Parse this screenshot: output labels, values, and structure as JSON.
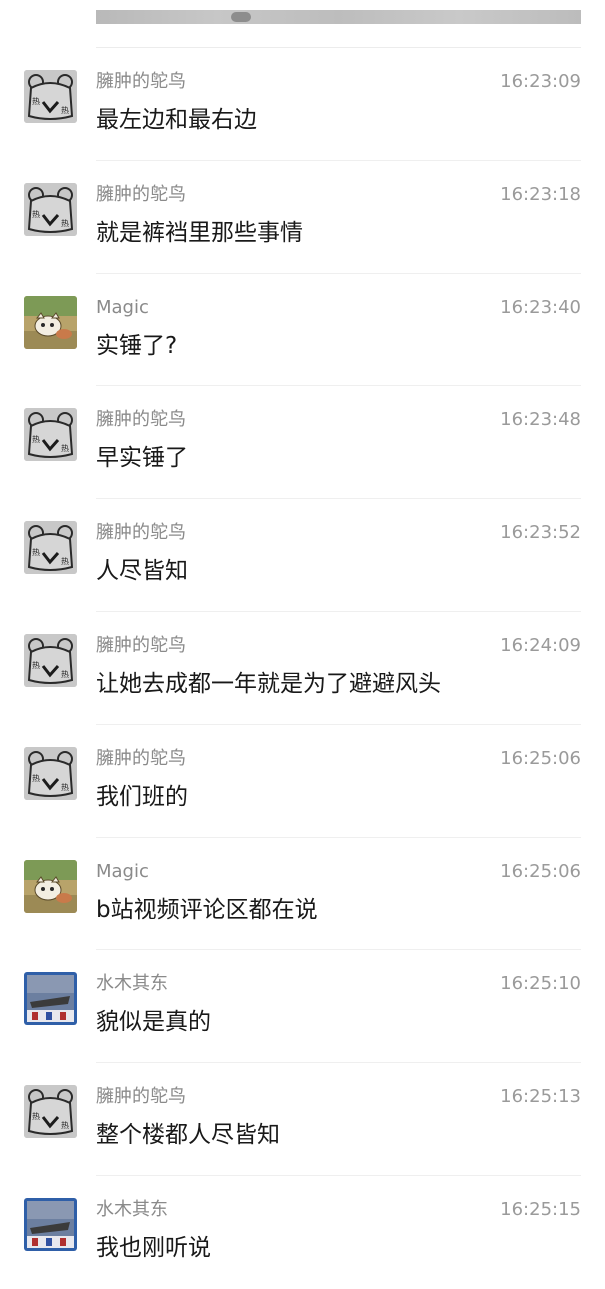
{
  "messages": [
    {
      "sender": "臃肿的鸵鸟",
      "time": "16:23:09",
      "text": "最左边和最右边",
      "avatar": "bear-sticker-avatar"
    },
    {
      "sender": "臃肿的鸵鸟",
      "time": "16:23:18",
      "text": "就是裤裆里那些事情",
      "avatar": "bear-sticker-avatar"
    },
    {
      "sender": "Magic",
      "time": "16:23:40",
      "text": "实锤了?",
      "avatar": "anime-cat-avatar"
    },
    {
      "sender": "臃肿的鸵鸟",
      "time": "16:23:48",
      "text": "早实锤了",
      "avatar": "bear-sticker-avatar"
    },
    {
      "sender": "臃肿的鸵鸟",
      "time": "16:23:52",
      "text": "人尽皆知",
      "avatar": "bear-sticker-avatar"
    },
    {
      "sender": "臃肿的鸵鸟",
      "time": "16:24:09",
      "text": "让她去成都一年就是为了避避风头",
      "avatar": "bear-sticker-avatar"
    },
    {
      "sender": "臃肿的鸵鸟",
      "time": "16:25:06",
      "text": "我们班的",
      "avatar": "bear-sticker-avatar"
    },
    {
      "sender": "Magic",
      "time": "16:25:06",
      "text": "b站视频评论区都在说",
      "avatar": "anime-cat-avatar"
    },
    {
      "sender": "水木其东",
      "time": "16:25:10",
      "text": "貌似是真的",
      "avatar": "ship-photo-avatar"
    },
    {
      "sender": "臃肿的鸵鸟",
      "time": "16:25:13",
      "text": "整个楼都人尽皆知",
      "avatar": "bear-sticker-avatar"
    },
    {
      "sender": "水木其东",
      "time": "16:25:15",
      "text": "我也刚听说",
      "avatar": "ship-photo-avatar"
    }
  ],
  "colors": {
    "name": "#8a8a8a",
    "time": "#9a9a9a",
    "text": "#191919",
    "divider": "#efefef",
    "background": "#ffffff"
  }
}
